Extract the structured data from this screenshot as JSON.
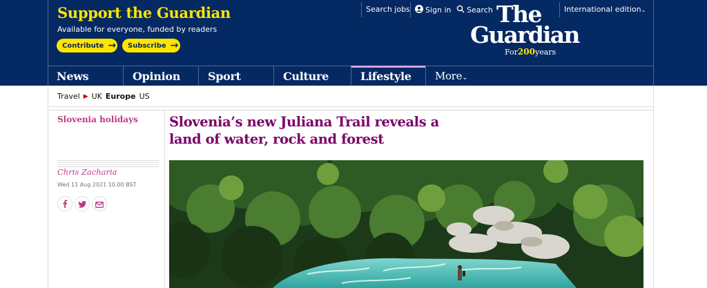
{
  "header": {
    "support_title": "Support the Guardian",
    "support_subtitle": "Available for everyone, funded by readers",
    "contribute_label": "Contribute",
    "subscribe_label": "Subscribe",
    "search_jobs": "Search jobs",
    "sign_in": "Sign in",
    "search": "Search",
    "edition": "International edition",
    "logo_line1": "The",
    "logo_line2": "Guardian",
    "logo_for": "For",
    "logo_years_num": "200",
    "logo_years": "years"
  },
  "nav": {
    "items": [
      {
        "label": "News"
      },
      {
        "label": "Opinion"
      },
      {
        "label": "Sport"
      },
      {
        "label": "Culture"
      },
      {
        "label": "Lifestyle"
      },
      {
        "label": "More"
      }
    ]
  },
  "breadcrumb": {
    "section": "Travel",
    "items": [
      "UK",
      "Europe",
      "US"
    ]
  },
  "article": {
    "series": "Slovenia holidays",
    "headline": "Slovenia’s new Juliana Trail reveals a land of water, rock and forest",
    "author": "Chris Zacharia",
    "date": "Wed 11 Aug 2021 10.00 BST"
  },
  "icons": {
    "signin": "user-icon",
    "search": "search-icon",
    "facebook": "facebook-icon",
    "twitter": "twitter-icon",
    "email": "email-icon"
  },
  "colors": {
    "brand": "#052962",
    "support_yellow": "#ffe500",
    "lifestyle_accent": "#7d0068",
    "lifestyle_pink": "#bb3b80"
  }
}
